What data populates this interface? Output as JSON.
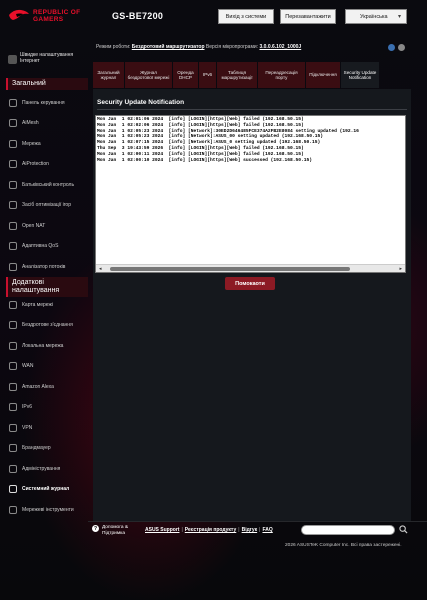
{
  "header": {
    "logo_line1": "REPUBLIC OF",
    "logo_line2": "GAMERS",
    "model": "GS-BE7200",
    "logout_label": "Вихід з системи",
    "reboot_label": "Перезавантажити",
    "language": "Українська"
  },
  "status": {
    "mode_label": "Режим роботи:",
    "mode_value": "Бездротовий маршрутизатор",
    "fw_label": "Версія мікропрограми:",
    "fw_value": "3.0.0.6.102_1000J"
  },
  "sidebar": {
    "quick_setup": "Швидке налаштування Інтернет",
    "section_general": "Загальний",
    "general_items": [
      {
        "label": "Панель керування",
        "icon": "dashboard-icon"
      },
      {
        "label": "AiMesh",
        "icon": "aimesh-icon"
      },
      {
        "label": "Мережа",
        "icon": "network-icon"
      },
      {
        "label": "AiProtection",
        "icon": "shield-icon"
      },
      {
        "label": "Батьківський контроль",
        "icon": "parental-icon"
      },
      {
        "label": "Засіб оптимізації ігор",
        "icon": "gamepad-icon"
      },
      {
        "label": "Open NAT",
        "icon": "open-nat-icon"
      },
      {
        "label": "Адаптивна QoS",
        "icon": "qos-icon"
      },
      {
        "label": "Аналізатор потоків",
        "icon": "traffic-analyzer-icon"
      }
    ],
    "section_advanced": "Додаткові налаштування",
    "advanced_items": [
      {
        "label": "Карта мережі",
        "icon": "network-map-icon"
      },
      {
        "label": "Бездротове з'єднання",
        "icon": "wireless-icon"
      },
      {
        "label": "Локальна мережа",
        "icon": "lan-icon"
      },
      {
        "label": "WAN",
        "icon": "wan-icon"
      },
      {
        "label": "Amazon Alexa",
        "icon": "alexa-icon"
      },
      {
        "label": "IPv6",
        "icon": "ipv6-icon"
      },
      {
        "label": "VPN",
        "icon": "vpn-icon"
      },
      {
        "label": "Брандмауер",
        "icon": "firewall-icon"
      },
      {
        "label": "Адміністрування",
        "icon": "admin-icon"
      },
      {
        "label": "Системний журнал",
        "icon": "system-log-icon"
      },
      {
        "label": "Мережеві інструменти",
        "icon": "network-tools-icon"
      }
    ]
  },
  "tabs": [
    {
      "label": "Загальний журнал"
    },
    {
      "label": "Журнал бездротової мережі"
    },
    {
      "label": "Оренда DHCP"
    },
    {
      "label": "IPv6"
    },
    {
      "label": "Таблиця маршрутизації"
    },
    {
      "label": "Переадресація порту"
    },
    {
      "label": "Підключення"
    },
    {
      "label": "Security Update Notification"
    }
  ],
  "main": {
    "title": "Security Update Notification",
    "log_lines": [
      "Mon Jan  1 02:01:06 2024  [info] [LOGIN][https][Web] failed (192.168.50.15)",
      "Mon Jan  1 02:02:06 2024  [info] [LOGIN][https][Web] failed (192.168.50.15)",
      "Mon Jan  1 02:05:23 2024  [info] [Network]:30ED2D646485FCE374A2FB2E8084 setting updated (192.16",
      "Mon Jan  1 02:05:23 2024  [info] [Network]:ASUS_00 setting updated (192.168.50.15)",
      "Mon Jan  1 02:07:15 2024  [info] [Network]:ASUS_0 setting updated (192.168.50.15)",
      "Thu Sep  3 19:43:59 2026  [info] [LOGIN][https][Web] failed (192.168.50.15)",
      "Mon Jan  1 02:00:11 2024  [info] [LOGIN][https][Web] failed (192.168.50.15)",
      "Mon Jan  1 02:00:10 2024  [info] [LOGIN][https][Web] successed (192.168.50.15)"
    ],
    "apply_label": "Помокаоти"
  },
  "footer": {
    "help_label": "Допомога & Підтримка",
    "links": [
      "ASUS Support",
      "Реєстрація продукту",
      "Відгук",
      "FAQ"
    ],
    "copyright": "2026 ASUSTeK Computer Inc. Всі права застережені."
  },
  "colors": {
    "accent": "#c8102e",
    "tab_bg": "#3a0d12",
    "panel_bg": "#15181d"
  }
}
